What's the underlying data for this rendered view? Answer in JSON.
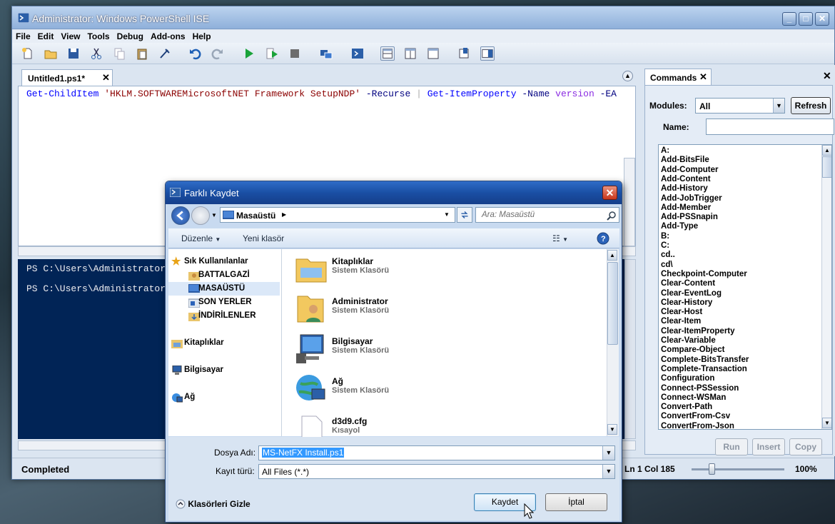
{
  "window": {
    "title": "Administrator: Windows PowerShell ISE",
    "menu": [
      "File",
      "Edit",
      "View",
      "Tools",
      "Debug",
      "Add-ons",
      "Help"
    ]
  },
  "editor": {
    "tab_label": "Untitled1.ps1*",
    "code_parts": [
      {
        "text": "Get-ChildItem ",
        "color": "#0000ff"
      },
      {
        "text": "'HKLM.SOFTWAREMicrosoftNET Framework SetupNDP'",
        "color": "#8b0000"
      },
      {
        "text": " -Recurse ",
        "color": "#000080"
      },
      {
        "text": "| ",
        "color": "#a9a9a9"
      },
      {
        "text": "Get-ItemProperty ",
        "color": "#0000ff"
      },
      {
        "text": "-Name ",
        "color": "#000080"
      },
      {
        "text": "version ",
        "color": "#8a2be2"
      },
      {
        "text": "-EA ",
        "color": "#000080"
      }
    ]
  },
  "console": {
    "lines": [
      "PS C:\\Users\\Administrator",
      "PS C:\\Users\\Administrator"
    ]
  },
  "status": {
    "text": "Completed",
    "position": "Ln 1  Col 185",
    "zoom": "100%"
  },
  "commands": {
    "tab_label": "Commands",
    "modules_label": "Modules:",
    "modules_value": "All",
    "refresh_label": "Refresh",
    "name_label": "Name:",
    "list": [
      "A:",
      "Add-BitsFile",
      "Add-Computer",
      "Add-Content",
      "Add-History",
      "Add-JobTrigger",
      "Add-Member",
      "Add-PSSnapin",
      "Add-Type",
      "B:",
      "C:",
      "cd..",
      "cd\\",
      "Checkpoint-Computer",
      "Clear-Content",
      "Clear-EventLog",
      "Clear-History",
      "Clear-Host",
      "Clear-Item",
      "Clear-ItemProperty",
      "Clear-Variable",
      "Compare-Object",
      "Complete-BitsTransfer",
      "Complete-Transaction",
      "Configuration",
      "Connect-PSSession",
      "Connect-WSMan",
      "Convert-Path",
      "ConvertFrom-Csv",
      "ConvertFrom-Json"
    ],
    "buttons": [
      "Run",
      "Insert",
      "Copy"
    ]
  },
  "dialog": {
    "title": "Farklı Kaydet",
    "address": "Masaüstü",
    "search_placeholder": "Ara: Masaüstü",
    "organize_label": "Düzenle",
    "new_folder_label": "Yeni klasör",
    "nav": {
      "favorites": "Sık Kullanılanlar",
      "fav_items": [
        "BATTALGAZİ",
        "MASAÜSTÜ",
        "SON YERLER",
        "İNDİRİLENLER"
      ],
      "libraries": "Kitaplıklar",
      "computer": "Bilgisayar",
      "network": "Ağ"
    },
    "files": [
      {
        "name": "Kitaplıklar",
        "type": "Sistem Klasörü"
      },
      {
        "name": "Administrator",
        "type": "Sistem Klasörü"
      },
      {
        "name": "Bilgisayar",
        "type": "Sistem Klasörü"
      },
      {
        "name": "Ağ",
        "type": "Sistem Klasörü"
      },
      {
        "name": "d3d9.cfg",
        "type": "Kısayol"
      }
    ],
    "filename_label": "Dosya Adı:",
    "filename_value": "MS-NetFX Install.ps1",
    "filetype_label": "Kayıt türü:",
    "filetype_value": "All Files (*.*)",
    "hide_folders_label": "Klasörleri Gizle",
    "save_label": "Kaydet",
    "cancel_label": "İptal"
  },
  "colors": {
    "console_bg": "#012456",
    "dialog_title": "#1a4fa4",
    "selection": "#3399ff"
  }
}
